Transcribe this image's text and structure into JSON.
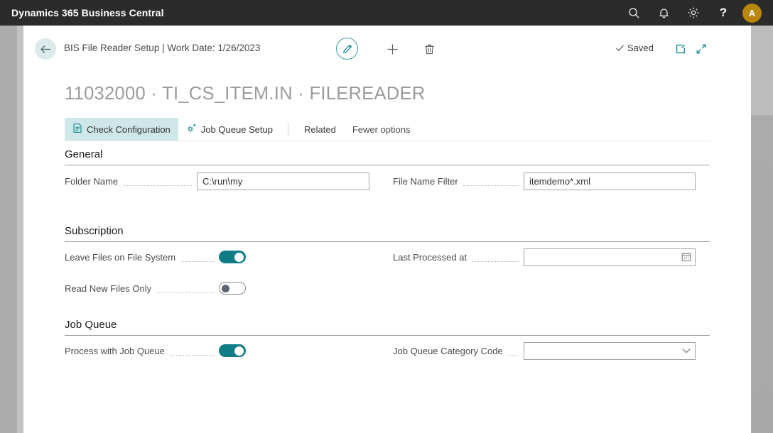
{
  "topbar": {
    "brand": "Dynamics 365 Business Central",
    "search_icon": "search-icon",
    "notifications_icon": "bell-icon",
    "settings_icon": "gear-icon",
    "help_label": "?",
    "avatar_initial": "A",
    "avatar_color": "#b8860b",
    "background_color": "#2b2b2b"
  },
  "command_bar": {
    "back_icon": "back-arrow-icon",
    "breadcrumb": "BIS File Reader Setup | Work Date: 1/26/2023",
    "edit_icon": "pencil-icon",
    "new_icon": "plus-icon",
    "delete_icon": "trash-icon",
    "saved_label": "Saved",
    "saved_check_icon": "check-icon",
    "open_in_new_icon": "open-in-new-window-icon",
    "collapse_icon": "collapse-icon",
    "accent_color": "#1a8a96"
  },
  "page": {
    "title": "11032000 · TI_CS_ITEM.IN · FILEREADER"
  },
  "ribbon": {
    "items": [
      {
        "label": "Check Configuration",
        "icon": "check-configuration-icon",
        "active": true
      },
      {
        "label": "Job Queue Setup",
        "icon": "job-queue-setup-icon",
        "active": false
      },
      {
        "label": "Related",
        "icon": "",
        "active": false
      },
      {
        "label": "Fewer options",
        "icon": "",
        "active": false
      }
    ],
    "active_background": "#cfe7e9"
  },
  "sections": [
    {
      "title": "General",
      "fields_left": [
        {
          "label": "Folder Name",
          "type": "text",
          "value": "C:\\run\\my",
          "placeholder": ""
        }
      ],
      "fields_right": [
        {
          "label": "File Name Filter",
          "type": "text",
          "value": "itemdemo*.xml",
          "placeholder": ""
        }
      ]
    },
    {
      "title": "Subscription",
      "fields_left": [
        {
          "label": "Leave Files on File System",
          "type": "toggle",
          "value": "on"
        },
        {
          "label": "Read New Files Only",
          "type": "toggle",
          "value": "off"
        }
      ],
      "fields_right": [
        {
          "label": "Last Processed at",
          "type": "datetime",
          "value": "",
          "placeholder": "",
          "icon": "calendar-icon"
        }
      ]
    },
    {
      "title": "Job Queue",
      "fields_left": [
        {
          "label": "Process with Job Queue",
          "type": "toggle",
          "value": "on"
        }
      ],
      "fields_right": [
        {
          "label": "Job Queue Category Code",
          "type": "dropdown",
          "value": "",
          "placeholder": "",
          "icon": "chevron-down-icon"
        }
      ]
    }
  ],
  "theme": {
    "toggle_on_color": "#0f7c86",
    "teal_accent": "#1a8a96",
    "title_color": "#9b9b9b",
    "desktop_gray": "#acacac"
  }
}
